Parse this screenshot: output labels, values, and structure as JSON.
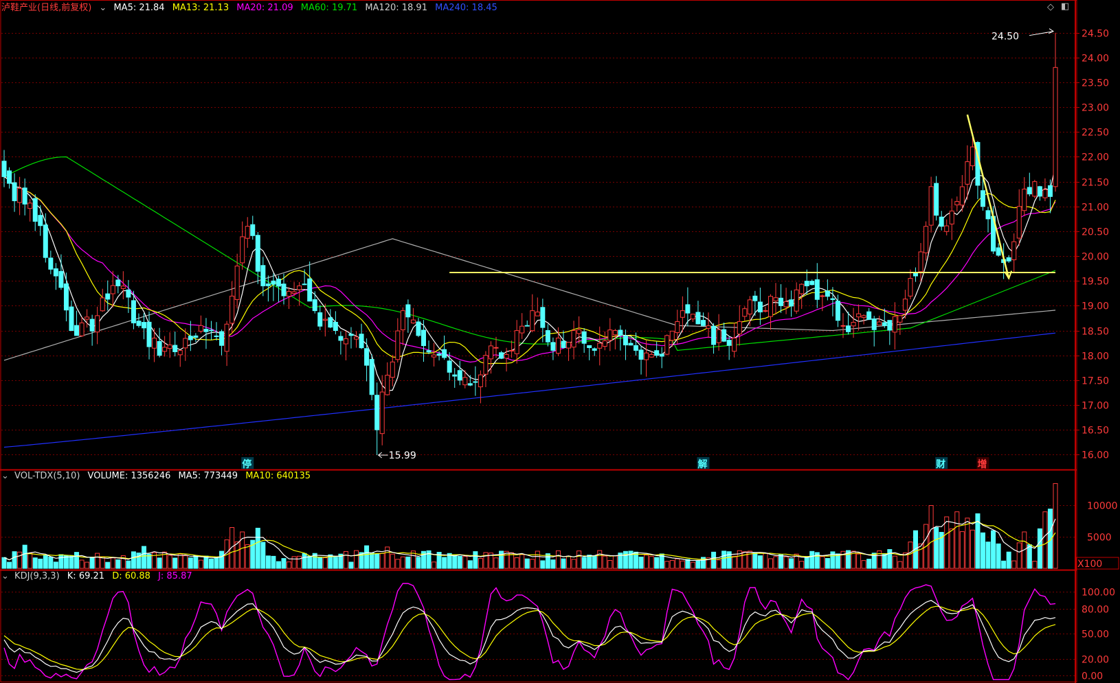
{
  "colors": {
    "up": "#ff3b3b",
    "down": "#54ffff",
    "frame": "#c00000",
    "grid": "#7a0000",
    "ma5": "#ffffff",
    "ma13": "#ffff00",
    "ma20": "#ff00ff",
    "ma60": "#00e000",
    "ma120": "#b0b0b0",
    "ma240": "#2030ff",
    "annot": "#ffff66"
  },
  "header_price": {
    "title": "泸鞋产业(日线,前复权)",
    "ma5": "MA5: 21.84",
    "ma13": "MA13: 21.13",
    "ma20": "MA20: 21.09",
    "ma60": "MA60: 19.71",
    "ma120": "MA120: 18.91",
    "ma240": "MA240: 18.45"
  },
  "header_vol": {
    "name": "VOL-TDX(5,10)",
    "volume": "VOLUME: 1356246",
    "ma5": "MA5: 773449",
    "ma10": "MA10: 640135"
  },
  "header_kdj": {
    "name": "KDJ(9,3,3)",
    "k": "K: 69.21",
    "d": "D: 60.88",
    "j": "J: 85.87"
  },
  "markers": [
    {
      "label": "停",
      "index": 47,
      "color": "#54ffff"
    },
    {
      "label": "解",
      "index": 135,
      "color": "#54ffff"
    },
    {
      "label": "财",
      "index": 181,
      "color": "#54ffff"
    },
    {
      "label": "增",
      "index": 189,
      "color": "#ff3b3b"
    }
  ],
  "chart_data": [
    {
      "type": "candlestick",
      "panel": "price",
      "ylim": [
        15.7,
        24.8
      ],
      "yticks": [
        16.0,
        16.5,
        17.0,
        17.5,
        18.0,
        18.5,
        19.0,
        19.5,
        20.0,
        20.5,
        21.0,
        21.5,
        22.0,
        22.5,
        23.0,
        23.5,
        24.0,
        24.5
      ],
      "tick_labels": [
        "16.00",
        "16.50",
        "17.00",
        "17.50",
        "18.00",
        "18.50",
        "19.00",
        "19.50",
        "20.00",
        "20.50",
        "21.00",
        "21.50",
        "22.00",
        "22.50",
        "23.00",
        "23.50",
        "24.00",
        "24.50"
      ],
      "n_bars": 204,
      "anchors": [
        {
          "i": 0,
          "c": 21.6
        },
        {
          "i": 6,
          "c": 20.7
        },
        {
          "i": 10,
          "c": 19.6
        },
        {
          "i": 14,
          "c": 18.4
        },
        {
          "i": 18,
          "c": 18.8
        },
        {
          "i": 22,
          "c": 19.4
        },
        {
          "i": 26,
          "c": 18.6
        },
        {
          "i": 30,
          "c": 18.0
        },
        {
          "i": 34,
          "c": 18.1
        },
        {
          "i": 38,
          "c": 18.6
        },
        {
          "i": 42,
          "c": 18.2
        },
        {
          "i": 45,
          "c": 19.8
        },
        {
          "i": 47,
          "c": 20.6
        },
        {
          "i": 50,
          "c": 19.4
        },
        {
          "i": 54,
          "c": 19.2
        },
        {
          "i": 57,
          "c": 19.4
        },
        {
          "i": 60,
          "c": 18.9
        },
        {
          "i": 64,
          "c": 18.5
        },
        {
          "i": 67,
          "c": 18.4
        },
        {
          "i": 70,
          "c": 17.8
        },
        {
          "i": 72,
          "c": 16.5
        },
        {
          "i": 74,
          "c": 17.6
        },
        {
          "i": 77,
          "c": 18.9
        },
        {
          "i": 80,
          "c": 18.4
        },
        {
          "i": 84,
          "c": 18.0
        },
        {
          "i": 88,
          "c": 17.5
        },
        {
          "i": 90,
          "c": 17.4
        },
        {
          "i": 93,
          "c": 18.0
        },
        {
          "i": 98,
          "c": 18.1
        },
        {
          "i": 102,
          "c": 18.9
        },
        {
          "i": 106,
          "c": 18.1
        },
        {
          "i": 110,
          "c": 18.5
        },
        {
          "i": 114,
          "c": 18.1
        },
        {
          "i": 118,
          "c": 18.5
        },
        {
          "i": 122,
          "c": 18.1
        },
        {
          "i": 126,
          "c": 18.0
        },
        {
          "i": 131,
          "c": 18.9
        },
        {
          "i": 135,
          "c": 18.6
        },
        {
          "i": 140,
          "c": 18.2
        },
        {
          "i": 145,
          "c": 19.1
        },
        {
          "i": 150,
          "c": 19.0
        },
        {
          "i": 155,
          "c": 19.4
        },
        {
          "i": 158,
          "c": 19.2
        },
        {
          "i": 162,
          "c": 18.6
        },
        {
          "i": 166,
          "c": 18.8
        },
        {
          "i": 170,
          "c": 18.6
        },
        {
          "i": 173,
          "c": 18.8
        },
        {
          "i": 176,
          "c": 19.6
        },
        {
          "i": 179,
          "c": 21.4
        },
        {
          "i": 181,
          "c": 20.6
        },
        {
          "i": 184,
          "c": 21.1
        },
        {
          "i": 187,
          "c": 22.2
        },
        {
          "i": 189,
          "c": 21.0
        },
        {
          "i": 191,
          "c": 20.1
        },
        {
          "i": 194,
          "c": 19.9
        },
        {
          "i": 196,
          "c": 21.0
        },
        {
          "i": 199,
          "c": 21.5
        },
        {
          "i": 202,
          "c": 21.2
        },
        {
          "i": 203,
          "c": 23.8
        }
      ],
      "high_label": "24.50",
      "high_value": 24.5,
      "low_label": "15.99",
      "low_value": 15.99,
      "low_index": 72,
      "support_line": {
        "price": 19.67,
        "from_index": 86,
        "to_index": 203
      },
      "trend_line": {
        "from": {
          "i": 186,
          "p": 22.85
        },
        "to": {
          "i": 194,
          "p": 19.55
        }
      },
      "ma_final": {
        "ma5": 21.84,
        "ma13": 21.13,
        "ma20": 21.09,
        "ma60": 19.71,
        "ma120": 18.91,
        "ma240": 18.45
      }
    },
    {
      "type": "bar",
      "panel": "volume",
      "ylim": [
        0,
        13000
      ],
      "yticks": [
        5000,
        10000
      ],
      "tick_labels": [
        "5000",
        "10000"
      ],
      "unit_label": "X100",
      "base_level": 1900,
      "bursts": [
        {
          "i": 4,
          "v": 3700
        },
        {
          "i": 27,
          "v": 3500
        },
        {
          "i": 44,
          "v": 6500
        },
        {
          "i": 46,
          "v": 5800
        },
        {
          "i": 49,
          "v": 6400
        },
        {
          "i": 70,
          "v": 3600
        },
        {
          "i": 74,
          "v": 3400
        },
        {
          "i": 120,
          "v": 2700
        },
        {
          "i": 156,
          "v": 2700
        },
        {
          "i": 171,
          "v": 3000
        },
        {
          "i": 176,
          "v": 6000
        },
        {
          "i": 179,
          "v": 10000
        },
        {
          "i": 182,
          "v": 8200
        },
        {
          "i": 184,
          "v": 9000
        },
        {
          "i": 186,
          "v": 8000
        },
        {
          "i": 188,
          "v": 8700
        },
        {
          "i": 191,
          "v": 6000
        },
        {
          "i": 197,
          "v": 5800
        },
        {
          "i": 201,
          "v": 9000
        },
        {
          "i": 203,
          "v": 13500
        }
      ]
    },
    {
      "type": "line",
      "panel": "kdj",
      "ylim": [
        -5,
        110
      ],
      "yticks": [
        0,
        20,
        50,
        80,
        100
      ],
      "tick_labels": [
        "0.00",
        "20.00",
        "50.00",
        "80.00",
        "100.00"
      ],
      "series_names": [
        "K",
        "D",
        "J"
      ],
      "final": {
        "K": 69.21,
        "D": 60.88,
        "J": 85.87
      }
    }
  ]
}
